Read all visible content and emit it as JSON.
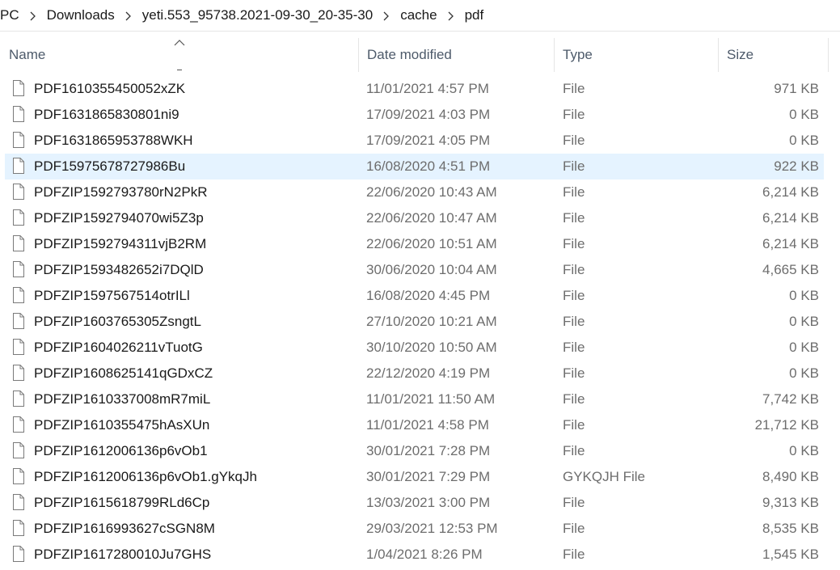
{
  "breadcrumb": {
    "items": [
      "PC",
      "Downloads",
      "yeti.553_95738.2021-09-30_20-35-30",
      "cache",
      "pdf"
    ]
  },
  "columns": {
    "name": "Name",
    "date": "Date modified",
    "type": "Type",
    "size": "Size",
    "sort_column": "Name",
    "sort_direction": "ascending"
  },
  "icons": {
    "file": "file-icon",
    "separator": "chevron-right-icon",
    "sort": "sort-up-icon"
  },
  "colors": {
    "selected_row": "#e5f3ff",
    "header_text": "#4d5a6a",
    "meta_text": "#6d6d6d"
  },
  "selected_index": 3,
  "files": [
    {
      "name": "PDF1610355450052xZK",
      "date": "11/01/2021 4:57 PM",
      "type": "File",
      "size": "971 KB"
    },
    {
      "name": "PDF1631865830801ni9",
      "date": "17/09/2021 4:03 PM",
      "type": "File",
      "size": "0 KB"
    },
    {
      "name": "PDF1631865953788WKH",
      "date": "17/09/2021 4:05 PM",
      "type": "File",
      "size": "0 KB"
    },
    {
      "name": "PDF15975678727986Bu",
      "date": "16/08/2020 4:51 PM",
      "type": "File",
      "size": "922 KB"
    },
    {
      "name": "PDFZIP1592793780rN2PkR",
      "date": "22/06/2020 10:43 AM",
      "type": "File",
      "size": "6,214 KB"
    },
    {
      "name": "PDFZIP1592794070wi5Z3p",
      "date": "22/06/2020 10:47 AM",
      "type": "File",
      "size": "6,214 KB"
    },
    {
      "name": "PDFZIP1592794311vjB2RM",
      "date": "22/06/2020 10:51 AM",
      "type": "File",
      "size": "6,214 KB"
    },
    {
      "name": "PDFZIP1593482652i7DQlD",
      "date": "30/06/2020 10:04 AM",
      "type": "File",
      "size": "4,665 KB"
    },
    {
      "name": "PDFZIP1597567514otrILl",
      "date": "16/08/2020 4:45 PM",
      "type": "File",
      "size": "0 KB"
    },
    {
      "name": "PDFZIP1603765305ZsngtL",
      "date": "27/10/2020 10:21 AM",
      "type": "File",
      "size": "0 KB"
    },
    {
      "name": "PDFZIP1604026211vTuotG",
      "date": "30/10/2020 10:50 AM",
      "type": "File",
      "size": "0 KB"
    },
    {
      "name": "PDFZIP1608625141qGDxCZ",
      "date": "22/12/2020 4:19 PM",
      "type": "File",
      "size": "0 KB"
    },
    {
      "name": "PDFZIP1610337008mR7miL",
      "date": "11/01/2021 11:50 AM",
      "type": "File",
      "size": "7,742 KB"
    },
    {
      "name": "PDFZIP1610355475hAsXUn",
      "date": "11/01/2021 4:58 PM",
      "type": "File",
      "size": "21,712 KB"
    },
    {
      "name": "PDFZIP1612006136p6vOb1",
      "date": "30/01/2021 7:28 PM",
      "type": "File",
      "size": "0 KB"
    },
    {
      "name": "PDFZIP1612006136p6vOb1.gYkqJh",
      "date": "30/01/2021 7:29 PM",
      "type": "GYKQJH File",
      "size": "8,490 KB"
    },
    {
      "name": "PDFZIP1615618799RLd6Cp",
      "date": "13/03/2021 3:00 PM",
      "type": "File",
      "size": "9,313 KB"
    },
    {
      "name": "PDFZIP1616993627cSGN8M",
      "date": "29/03/2021 12:53 PM",
      "type": "File",
      "size": "8,535 KB"
    },
    {
      "name": "PDFZIP1617280010Ju7GHS",
      "date": "1/04/2021 8:26 PM",
      "type": "File",
      "size": "1,545 KB"
    }
  ]
}
